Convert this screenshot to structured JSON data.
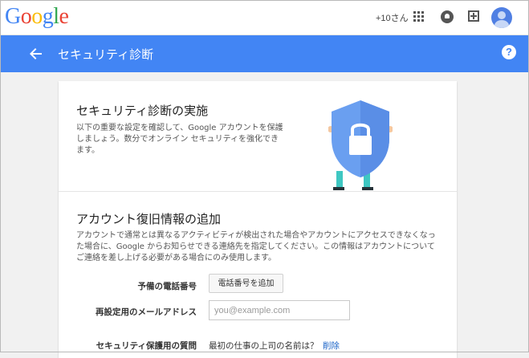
{
  "topbar": {
    "logo_letters": [
      {
        "ch": "G",
        "color": "#4285f4"
      },
      {
        "ch": "o",
        "color": "#ea4335"
      },
      {
        "ch": "o",
        "color": "#fbbc05"
      },
      {
        "ch": "g",
        "color": "#4285f4"
      },
      {
        "ch": "l",
        "color": "#34a853"
      },
      {
        "ch": "e",
        "color": "#ea4335"
      }
    ],
    "plus_user": "+10さん",
    "icons": [
      "apps-icon",
      "notifications-icon",
      "share-icon",
      "avatar"
    ]
  },
  "appbar": {
    "title": "セキュリティ診断",
    "color": "#4285f4"
  },
  "intro": {
    "title": "セキュリティ診断の実施",
    "description": "以下の重要な設定を確認して、Google アカウントを保護しましょう。数分でオンライン セキュリティを強化できます。"
  },
  "recovery": {
    "title": "アカウント復旧情報の追加",
    "description": "アカウントで通常とは異なるアクティビティが検出された場合やアカウントにアクセスできなくなった場合に、Google からお知らせできる連絡先を指定してください。この情報はアカウントについてご連絡を差し上げる必要がある場合にのみ使用します。",
    "phone_label": "予備の電話番号",
    "add_phone_label": "電話番号を追加",
    "email_label": "再設定用のメールアドレス",
    "email_placeholder": "you@example.com",
    "email_value": "",
    "security_question_label": "セキュリティ保護用の質問",
    "security_question_value": "最初の仕事の上司の名前は？",
    "delete_label": "削除"
  }
}
